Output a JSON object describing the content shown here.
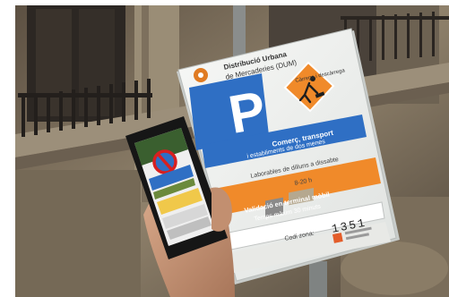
{
  "sign": {
    "header_line1": "Distribució Urbana",
    "header_line2": "de Mercaderies (DUM)",
    "subtitle": "Càrrega i descàrrega",
    "parking_letter": "P",
    "blue_band": [
      "Comerç, transport",
      "i establiments de dos menes"
    ],
    "schedule": [
      "Laborables de dilluns a dissabte",
      "8-20 h"
    ],
    "orange_band": [
      "Validació en terminal mòbil",
      "Temps màxim 30 minuts"
    ],
    "zone_label": "Codi zona:",
    "zone_code": "1351"
  },
  "colors": {
    "parking_blue": "#2f6fc4",
    "sign_white": "#f2f4f3",
    "band_orange": "#f08a2a",
    "phone_screen_blue": "#3a72c0",
    "phone_screen_yellow": "#f0c84a"
  },
  "icons": [
    "no-parking-icon",
    "road-work-warning-icon",
    "qr-code-icon",
    "logo-icon"
  ]
}
